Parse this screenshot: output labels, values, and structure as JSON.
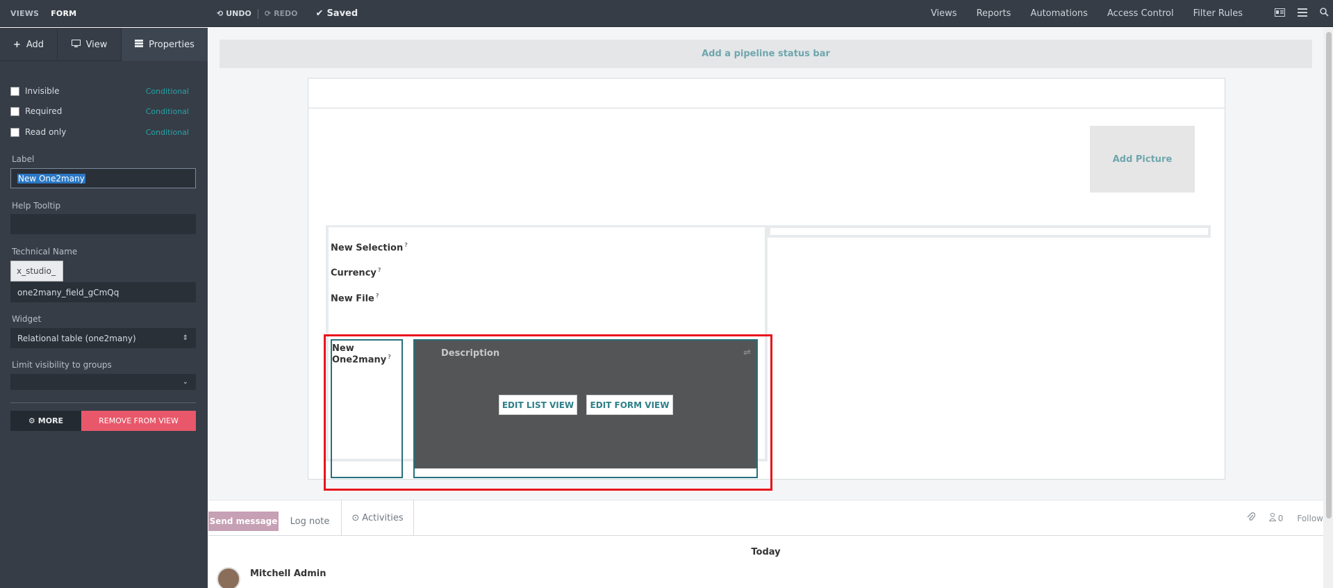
{
  "topbar": {
    "views": "VIEWS",
    "form": "FORM",
    "undo": "UNDO",
    "redo": "REDO",
    "saved": "Saved",
    "menu": [
      "Views",
      "Reports",
      "Automations",
      "Access Control",
      "Filter Rules"
    ]
  },
  "sidebar": {
    "tabs": {
      "add": "Add",
      "view": "View",
      "properties": "Properties"
    },
    "invisible": "Invisible",
    "required": "Required",
    "readonly": "Read only",
    "conditional": "Conditional",
    "label_title": "Label",
    "label_value": "New One2many",
    "help_title": "Help Tooltip",
    "help_value": "",
    "tech_title": "Technical Name",
    "tech_prefix": "x_studio_",
    "tech_value": "one2many_field_gCmQq",
    "widget_title": "Widget",
    "widget_value": "Relational table (one2many)",
    "groups_title": "Limit visibility to groups",
    "groups_value": "",
    "more": "MORE",
    "remove": "REMOVE FROM VIEW"
  },
  "form": {
    "pipeline": "Add a pipeline status bar",
    "add_picture": "Add Picture",
    "fields": [
      "New Selection",
      "Currency",
      "New File"
    ],
    "o2m_label": "New One2many",
    "help_mark": "?",
    "column_header": "Description",
    "edit_list": "EDIT LIST VIEW",
    "edit_form": "EDIT FORM VIEW"
  },
  "chatter": {
    "send": "Send message",
    "log": "Log note",
    "activities": "Activities",
    "followers_count": "0",
    "follow": "Follow",
    "today": "Today",
    "author": "Mitchell Admin"
  },
  "colors": {
    "topbar": "#363d47",
    "accent_teal": "#26a3a7",
    "remove_red": "#e8586a",
    "highlight": "#e8151c",
    "send_button": "#c6a0b4"
  }
}
